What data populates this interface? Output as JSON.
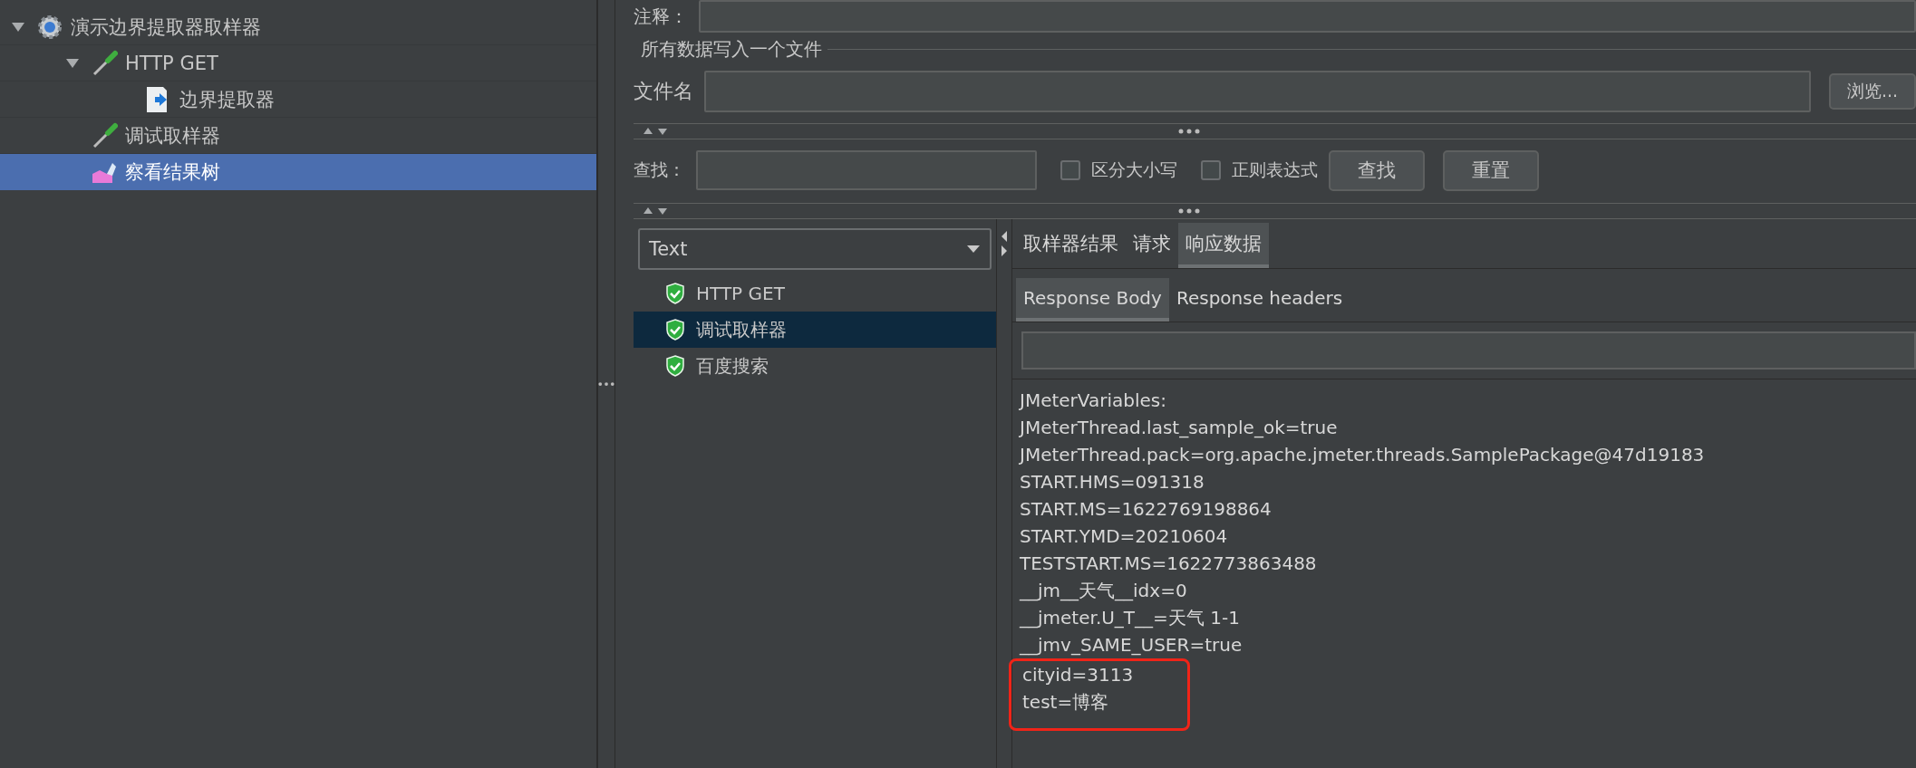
{
  "tree": {
    "items": [
      {
        "label": "演示边界提取器取样器",
        "kind": "gear",
        "expanded": true,
        "selected": false,
        "children": [
          {
            "label": "HTTP GET",
            "kind": "sampler",
            "expanded": true,
            "selected": false,
            "children": [
              {
                "label": "边界提取器",
                "kind": "extractor",
                "selected": false
              }
            ]
          },
          {
            "label": "调试取样器",
            "kind": "sampler",
            "selected": false
          },
          {
            "label": "察看结果树",
            "kind": "listener",
            "selected": true
          }
        ]
      }
    ]
  },
  "comment": {
    "label": "注释："
  },
  "file_group": {
    "legend": "所有数据写入一个文件",
    "label": "文件名",
    "browse_button": "浏览..."
  },
  "search": {
    "label": "查找：",
    "options": [
      {
        "label": "区分大小写",
        "checked": false
      },
      {
        "label": "正则表达式",
        "checked": false
      }
    ],
    "buttons": [
      "查找",
      "重置"
    ]
  },
  "renderer": {
    "value": "Text"
  },
  "samples": [
    {
      "label": "HTTP GET",
      "kind": "success",
      "selected": false
    },
    {
      "label": "调试取样器",
      "kind": "success",
      "selected": true
    },
    {
      "label": "百度搜索",
      "kind": "success",
      "selected": false
    }
  ],
  "tabs": [
    {
      "label": "取样器结果",
      "selected": false
    },
    {
      "label": "请求",
      "selected": false
    },
    {
      "label": "响应数据",
      "selected": true
    }
  ],
  "subtabs": [
    {
      "label": "Response Body",
      "selected": true
    },
    {
      "label": "Response headers",
      "selected": false
    }
  ],
  "response_lines": [
    {
      "text": "JMeterVariables:",
      "highlighted": false
    },
    {
      "text": "JMeterThread.last_sample_ok=true",
      "highlighted": false
    },
    {
      "text": "JMeterThread.pack=org.apache.jmeter.threads.SamplePackage@47d19183",
      "highlighted": false
    },
    {
      "text": "START.HMS=091318",
      "highlighted": false
    },
    {
      "text": "START.MS=1622769198864",
      "highlighted": false
    },
    {
      "text": "START.YMD=20210604",
      "highlighted": false
    },
    {
      "text": "TESTSTART.MS=1622773863488",
      "highlighted": false
    },
    {
      "text": "__jm__天气__idx=0",
      "highlighted": false
    },
    {
      "text": "__jmeter.U_T__=天气 1-1",
      "highlighted": false
    },
    {
      "text": "__jmv_SAME_USER=true",
      "highlighted": false
    },
    {
      "text": "cityid=3113",
      "highlighted": true
    },
    {
      "text": "test=博客",
      "highlighted": true
    }
  ]
}
